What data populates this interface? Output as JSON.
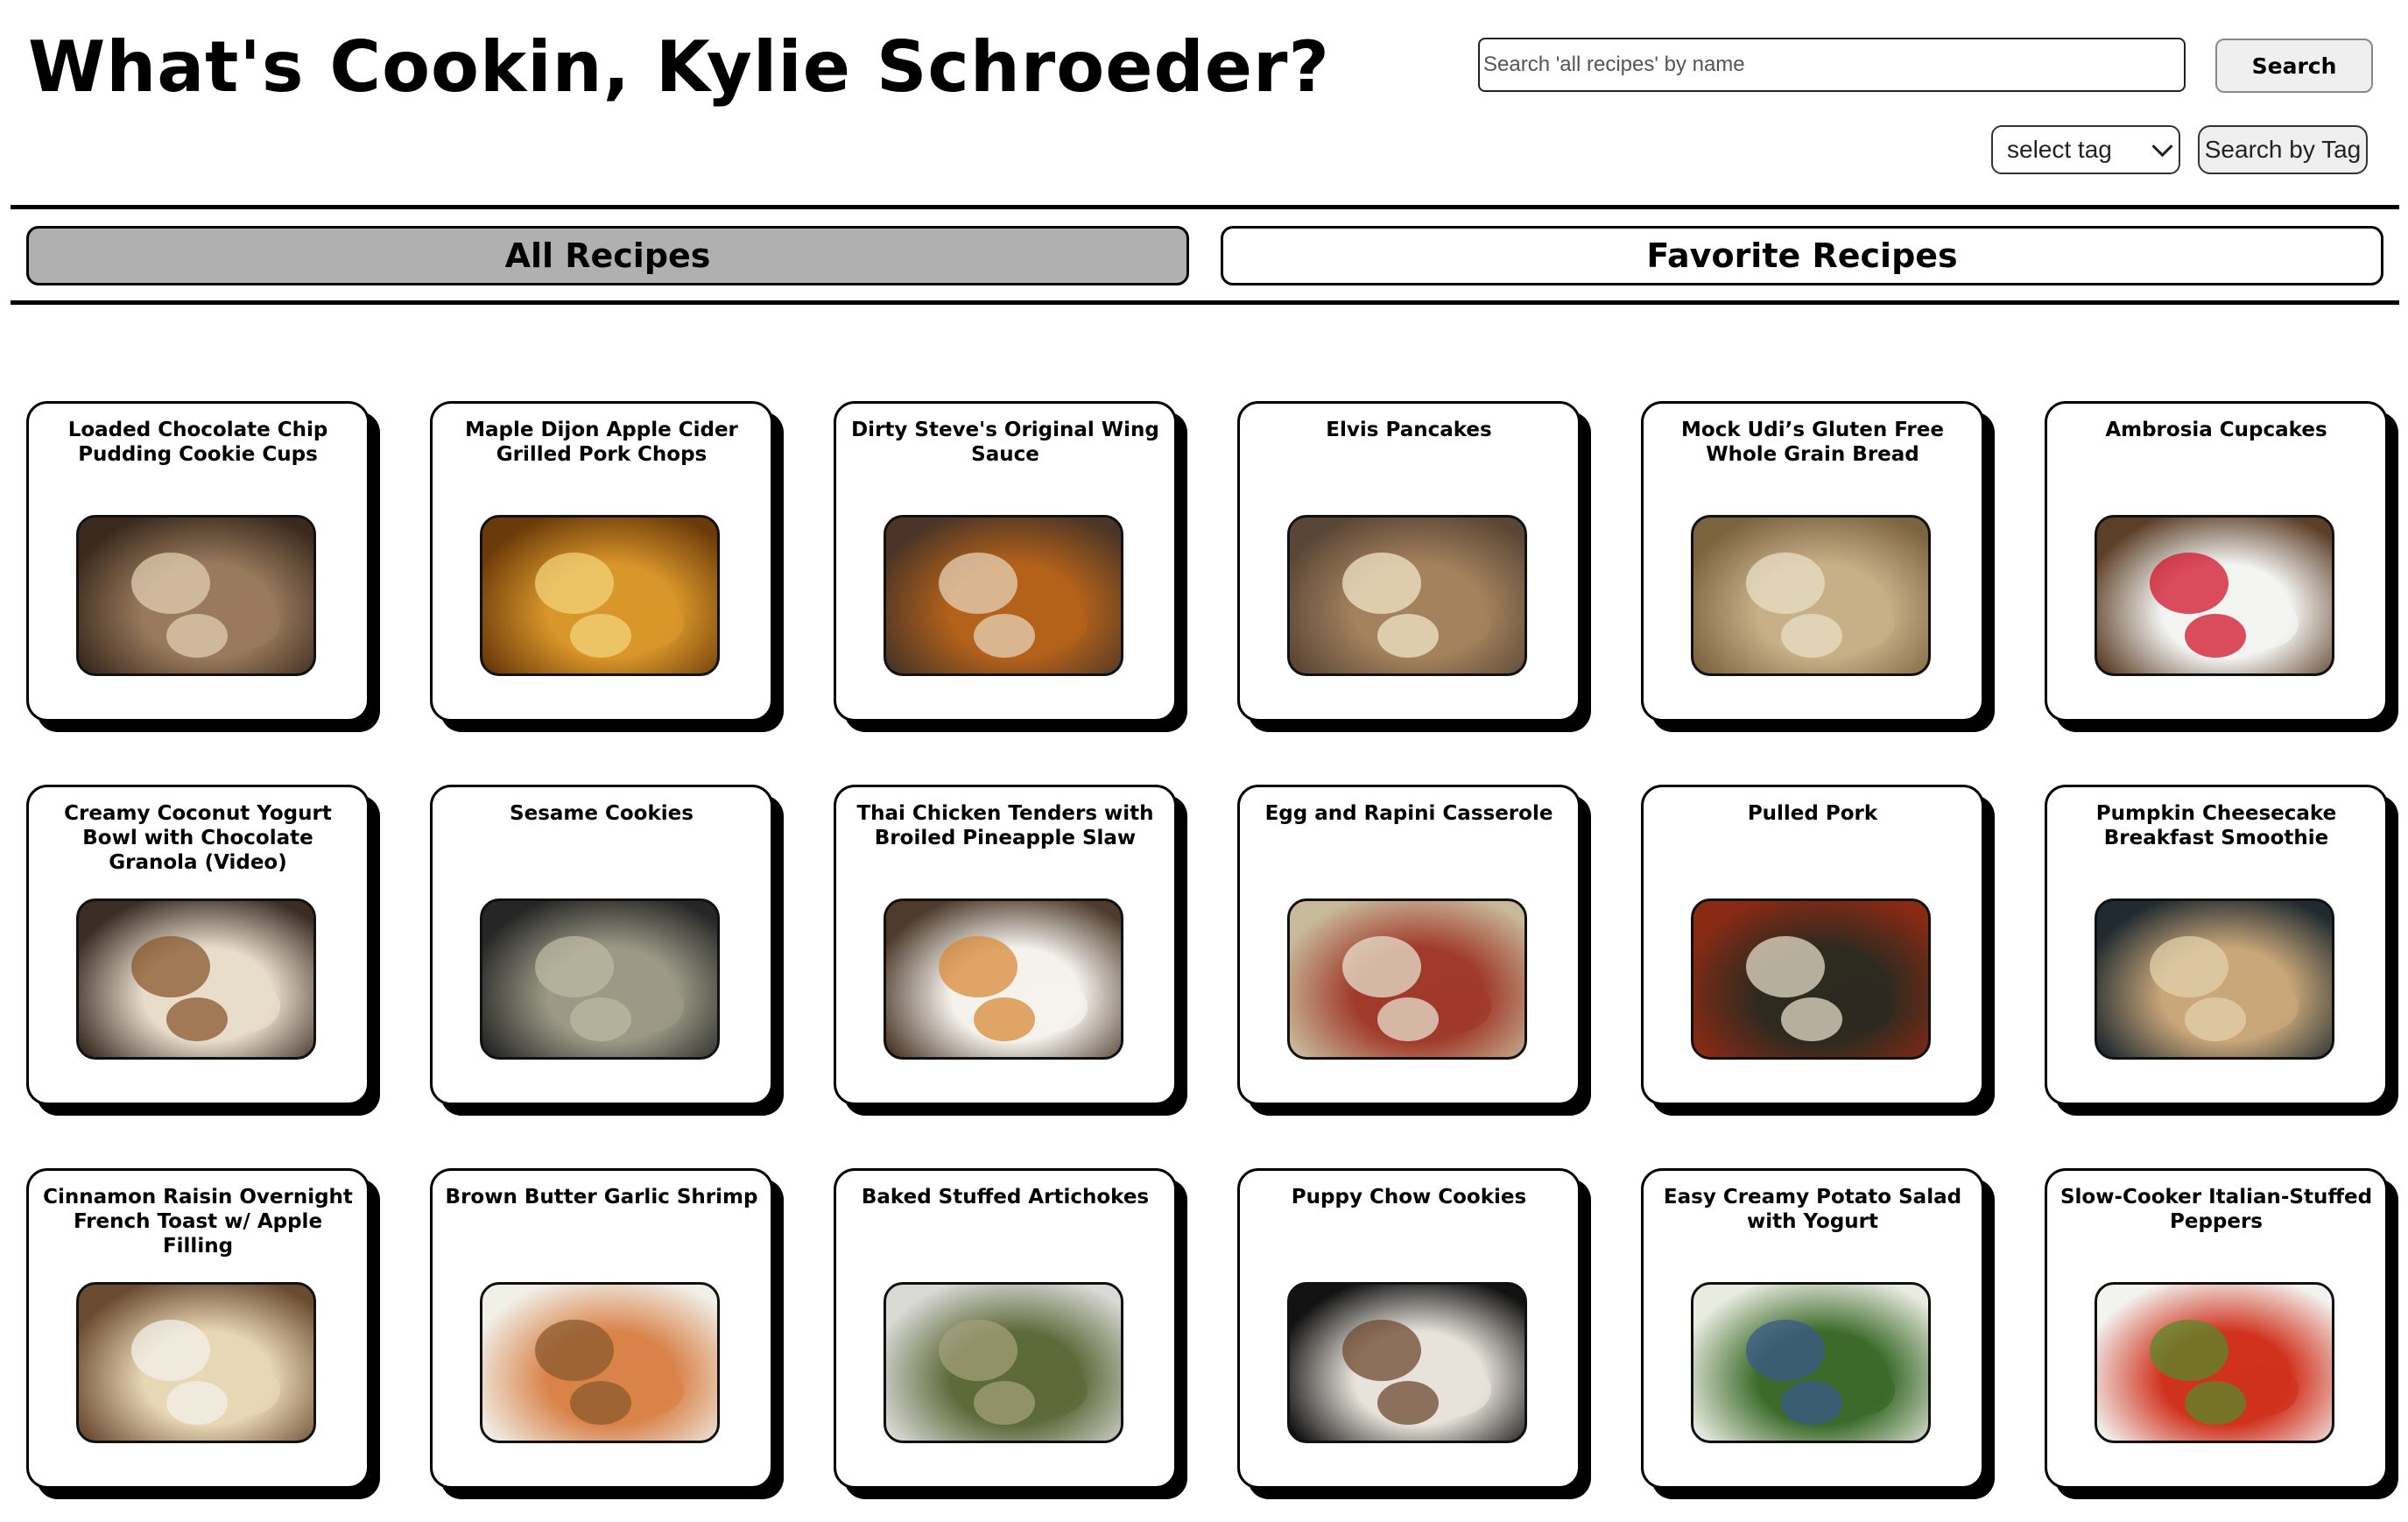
{
  "header": {
    "title": "What's Cookin, Kylie Schroeder?",
    "search_placeholder": "Search 'all recipes' by name",
    "search_label": "Search",
    "tag_select_value": "select tag",
    "tag_search_label": "Search by Tag"
  },
  "tabs": {
    "all_label": "All Recipes",
    "favorites_label": "Favorite Recipes"
  },
  "recipes": [
    {
      "title": "Loaded Chocolate Chip Pudding Cookie Cups",
      "colors": [
        "#3a2a1e",
        "#9a7a5c",
        "#e0cdb0"
      ]
    },
    {
      "title": "Maple Dijon Apple Cider Grilled Pork Chops",
      "colors": [
        "#6b3a0a",
        "#d9962a",
        "#f2d27a"
      ]
    },
    {
      "title": "Dirty Steve's Original Wing Sauce",
      "colors": [
        "#4b3527",
        "#b4621a",
        "#e6d2b8"
      ]
    },
    {
      "title": "Elvis Pancakes",
      "colors": [
        "#5a4636",
        "#a4825d",
        "#f0e6c8"
      ]
    },
    {
      "title": "Mock Udi’s Gluten Free Whole Grain Bread",
      "colors": [
        "#7d6440",
        "#c7b088",
        "#e9e0c6"
      ]
    },
    {
      "title": "Ambrosia Cupcakes",
      "colors": [
        "#5d3f28",
        "#f4f4f2",
        "#d2142a"
      ]
    },
    {
      "title": "Creamy Coconut Yogurt Bowl with Chocolate Granola (Video)",
      "colors": [
        "#3b2c24",
        "#e8dccb",
        "#8a5a2e"
      ]
    },
    {
      "title": "Sesame Cookies",
      "colors": [
        "#262626",
        "#9c9a86",
        "#bcb8a2"
      ]
    },
    {
      "title": "Thai Chicken Tenders with Broiled Pineapple Slaw",
      "colors": [
        "#4e3b2c",
        "#f5f2ec",
        "#d88a3a"
      ]
    },
    {
      "title": "Egg and Rapini Casserole",
      "colors": [
        "#c8b99a",
        "#a03a2a",
        "#e8e1cf"
      ]
    },
    {
      "title": "Pulled Pork",
      "colors": [
        "#8a2a14",
        "#2d2a20",
        "#e4dcc8"
      ]
    },
    {
      "title": "Pumpkin Cheesecake Breakfast Smoothie",
      "colors": [
        "#202a30",
        "#c9a77a",
        "#e2d0ac"
      ]
    },
    {
      "title": "Cinnamon Raisin Overnight French Toast w/ Apple Filling",
      "colors": [
        "#6a4a30",
        "#e8d7b4",
        "#f2f0ea"
      ]
    },
    {
      "title": "Brown Butter Garlic Shrimp",
      "colors": [
        "#f0efe8",
        "#d9834a",
        "#8a5a2e"
      ]
    },
    {
      "title": "Baked Stuffed Artichokes",
      "colors": [
        "#d9d9d6",
        "#5d6a3a",
        "#a4a07a"
      ]
    },
    {
      "title": "Puppy Chow Cookies",
      "colors": [
        "#121212",
        "#e7e3da",
        "#6d4a30"
      ]
    },
    {
      "title": "Easy Creamy Potato Salad with Yogurt",
      "colors": [
        "#e9ebe0",
        "#3b6a2a",
        "#3a5a8a"
      ]
    },
    {
      "title": "Slow-Cooker Italian-Stuffed Peppers",
      "colors": [
        "#f2f2ef",
        "#d0321e",
        "#5a8a2a"
      ]
    }
  ]
}
